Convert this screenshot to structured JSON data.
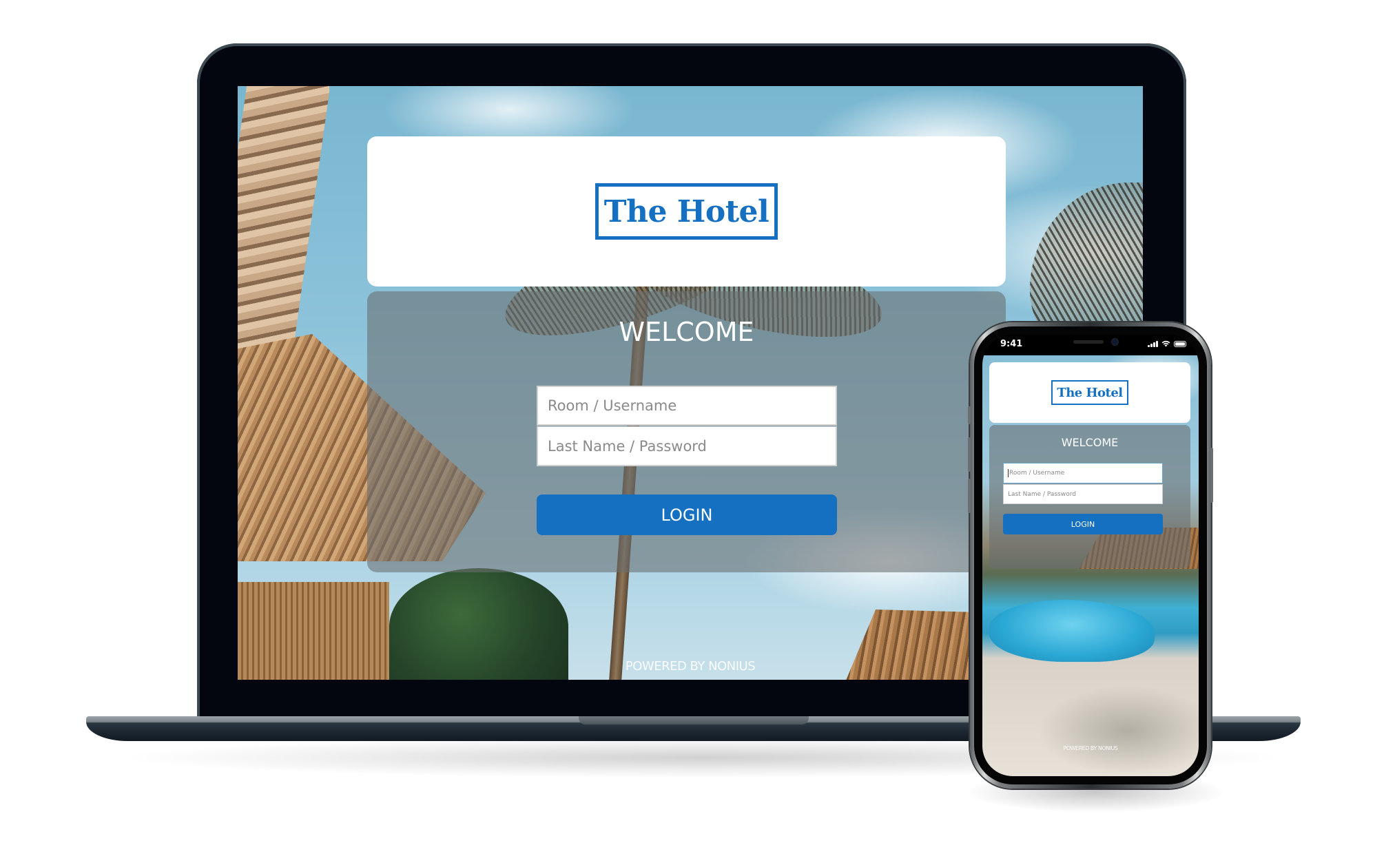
{
  "brand": {
    "name": "The Hotel",
    "primary_color": "#1570c2"
  },
  "laptop": {
    "login": {
      "welcome": "WELCOME",
      "username_placeholder": "Room / Username",
      "password_placeholder": "Last Name / Password",
      "login_label": "LOGIN"
    },
    "footer": "POWERED BY NONIUS"
  },
  "phone": {
    "status_bar": {
      "time": "9:41",
      "signal_icon": "cellular-signal-icon",
      "wifi_icon": "wifi-icon",
      "battery_icon": "battery-icon"
    },
    "login": {
      "welcome": "WELCOME",
      "username_placeholder": "Room / Username",
      "password_placeholder": "Last Name / Password",
      "login_label": "LOGIN",
      "focused_field": "username"
    },
    "footer": "POWERED BY NONIUS"
  }
}
